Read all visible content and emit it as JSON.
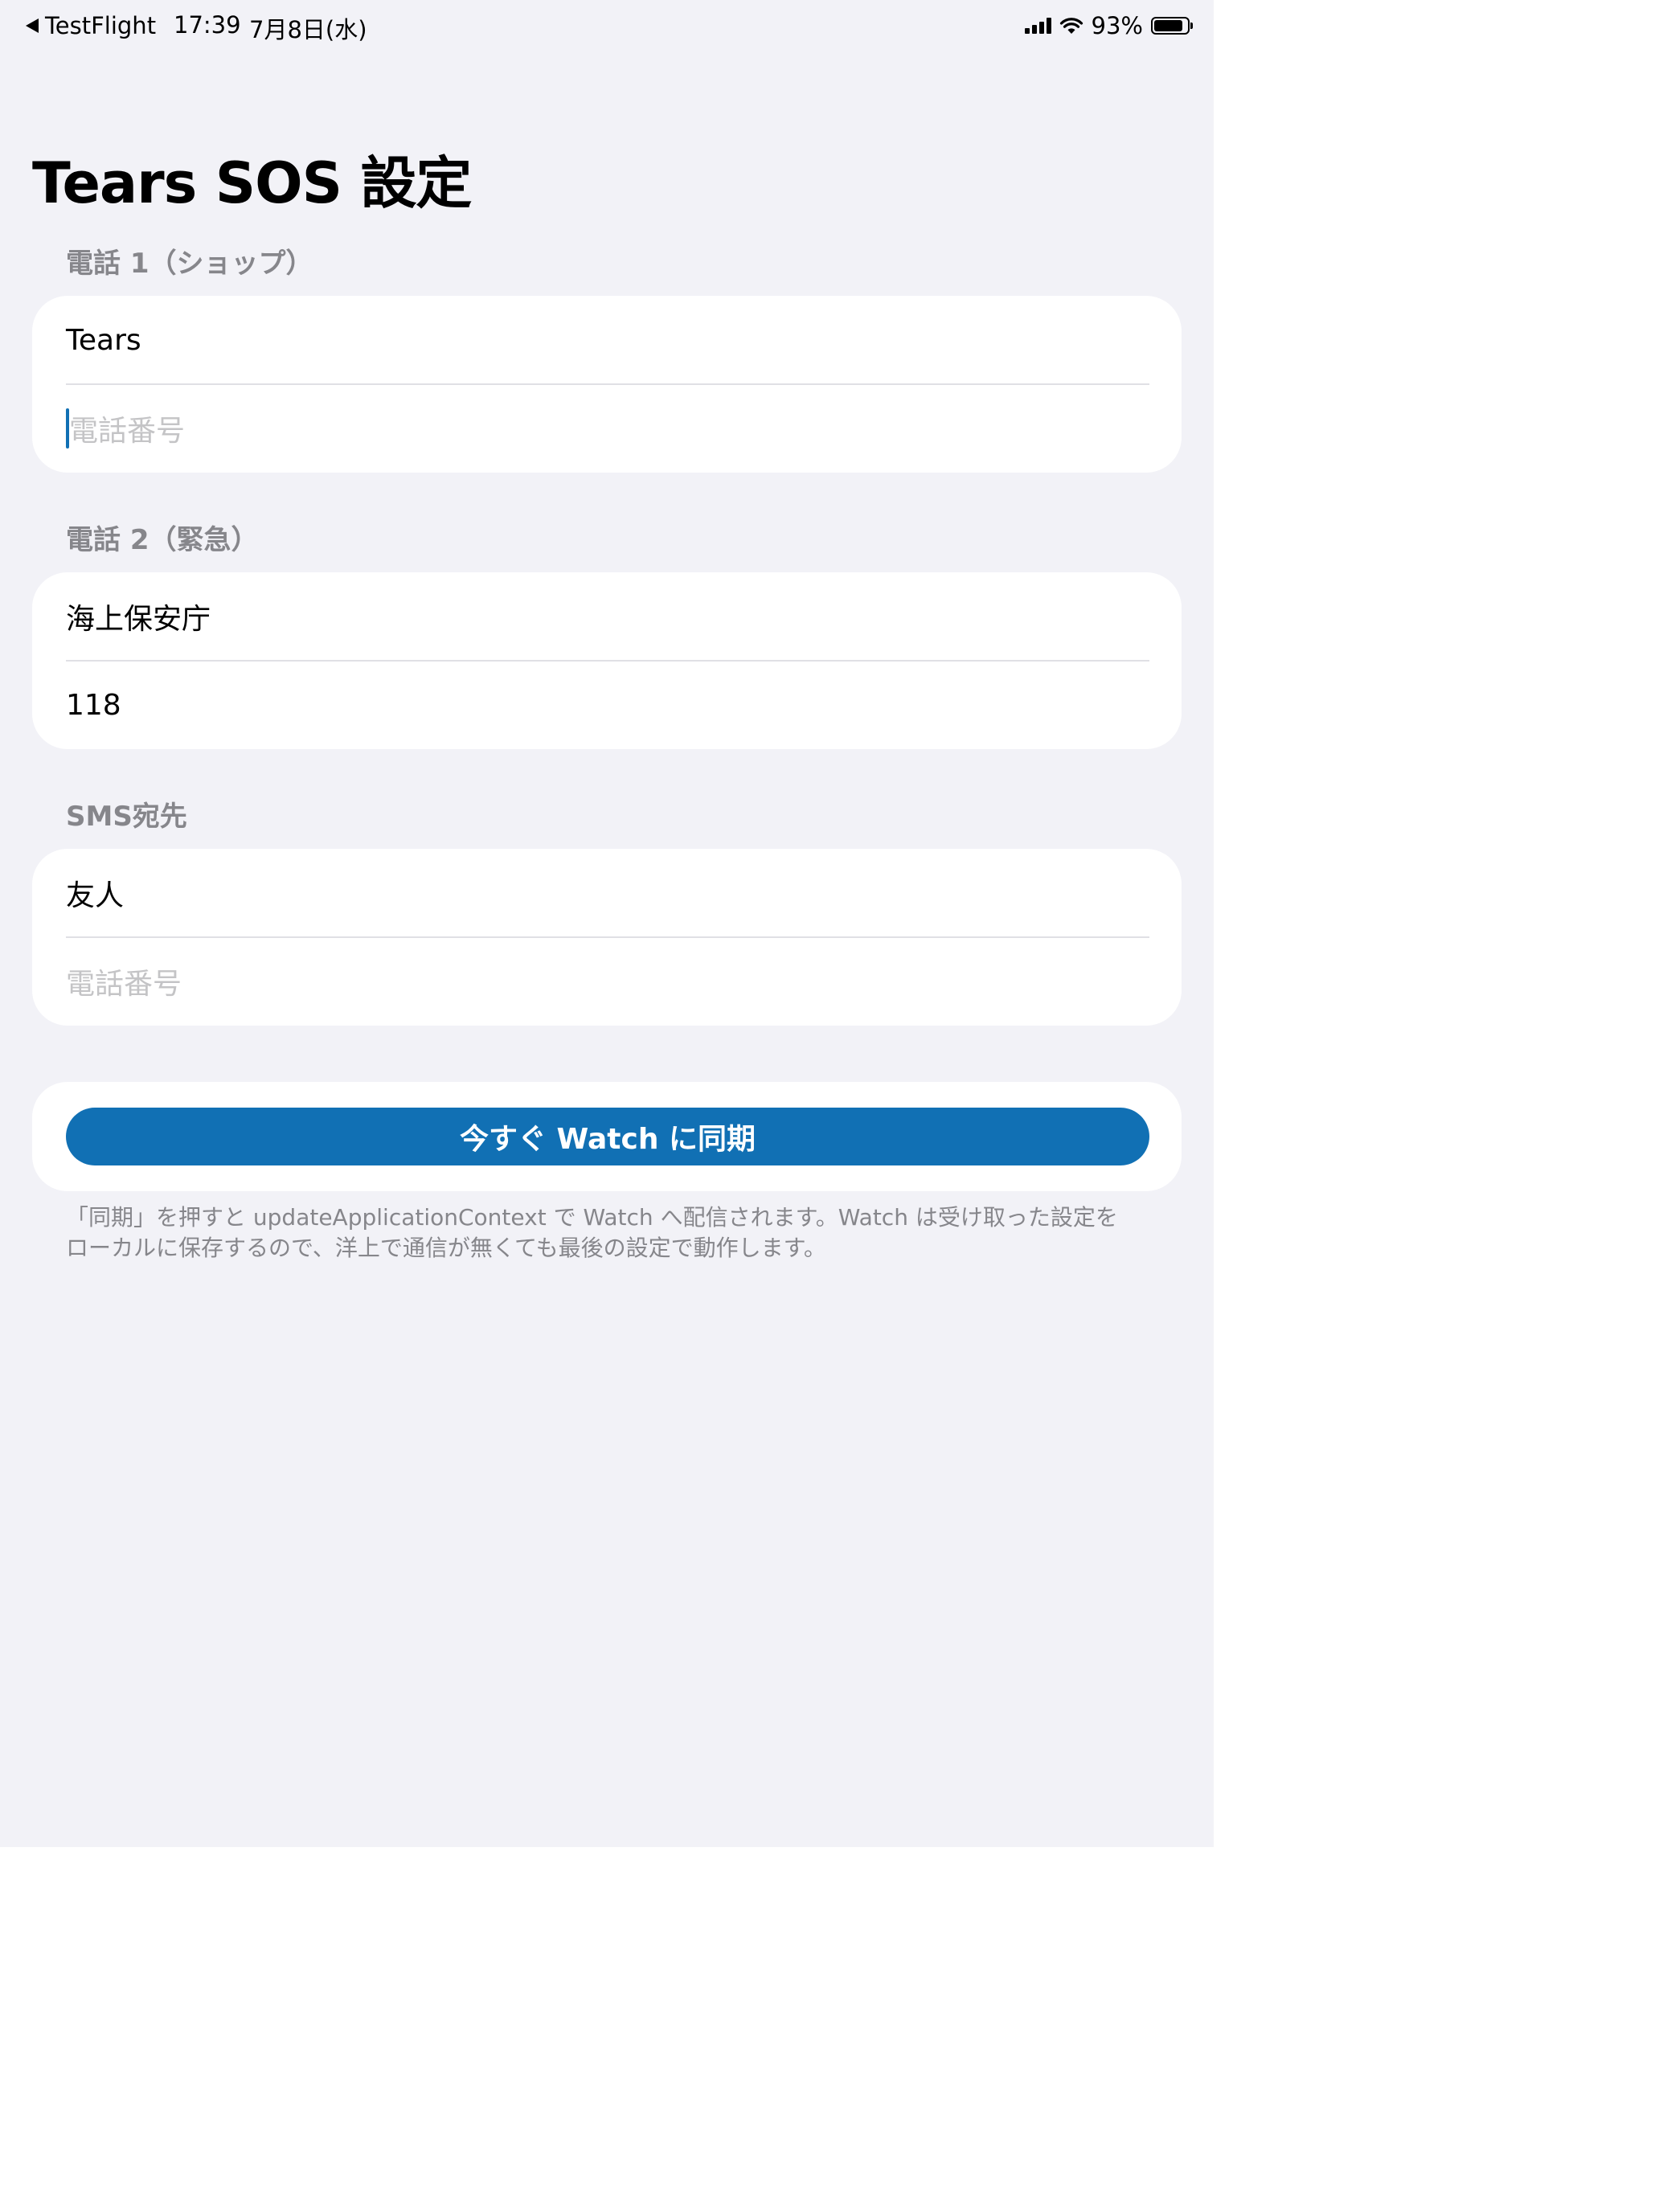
{
  "status_bar": {
    "back_app": "TestFlight",
    "time": "17:39",
    "date": "7月8日(水)",
    "battery": "93%"
  },
  "page": {
    "title": "Tears SOS 設定"
  },
  "sections": [
    {
      "header": "電話 1（ショップ）",
      "name_value": "Tears",
      "phone_value": "",
      "phone_placeholder": "電話番号"
    },
    {
      "header": "電話 2（緊急）",
      "name_value": "海上保安庁",
      "phone_value": "118"
    },
    {
      "header": "SMS宛先",
      "name_value": "友人",
      "phone_value": "",
      "phone_placeholder": "電話番号"
    }
  ],
  "sync": {
    "button_label": "今すぐ Watch に同期",
    "footnote_line1": "「同期」を押すと updateApplicationContext で Watch へ配信されます。Watch は受け取った設定を",
    "footnote_line2": "ローカルに保存するので、洋上で通信が無くても最後の設定で動作します。"
  },
  "colors": {
    "background": "#f2f2f7",
    "accent": "#1170b4",
    "secondary_text": "#86868b",
    "placeholder": "#c4c4c6"
  },
  "icons": {
    "back": "back-triangle-icon",
    "signal": "cellular-signal-icon",
    "wifi": "wifi-icon",
    "battery": "battery-icon"
  }
}
